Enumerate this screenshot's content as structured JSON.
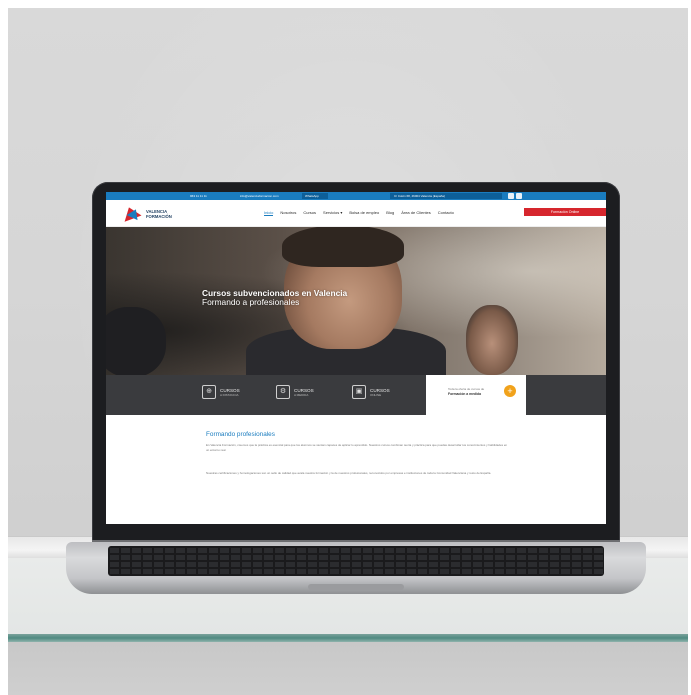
{
  "website": {
    "topbar": {
      "phone": "963 11 11 11",
      "email": "info@valenciaformacion.com",
      "whatsapp": "WhatsApp",
      "address": "C/ Colón 68, 46004 Valencia (España)"
    },
    "logo": {
      "line1": "VALENCIA",
      "line2": "FORMACIÓN"
    },
    "menu": [
      "Inicio",
      "Nosotros",
      "Cursos",
      "Servicios ▾",
      "Bolsa de empleo",
      "Blog",
      "Área de Clientes",
      "Contacto"
    ],
    "cta": "Formación Online",
    "hero": {
      "title": "Cursos subvencionados en Valencia",
      "subtitle": "Formando a profesionales"
    },
    "courses": [
      {
        "icon": "⊕",
        "title": "CURSOS",
        "sub": "A DISTANCIA"
      },
      {
        "icon": "⚙",
        "title": "CURSOS",
        "sub": "A MEDIDA"
      },
      {
        "icon": "▣",
        "title": "CURSOS",
        "sub": "ONLINE"
      }
    ],
    "info_card": {
      "small": "Toda la oferta de cursos de",
      "bold": "Formación a medida",
      "plus": "+"
    },
    "content": {
      "heading": "Formando profesionales",
      "para1": "En Valencia Formación, creemos que la práctica es esencial para que los alumnos se sientan capaces de aplicar lo aprendido. Nuestros cursos combinan teoría y práctica para que puedas desarrollar tus conocimientos y habilidades en un entorno real.",
      "para2": "Nuestras certificaciones y homologaciones son un sello de calidad que avala nuestra formación y la de nuestros profesionales, reconocidos por empresas e instituciones de toda la Comunidad Valenciana y resto de España."
    }
  }
}
